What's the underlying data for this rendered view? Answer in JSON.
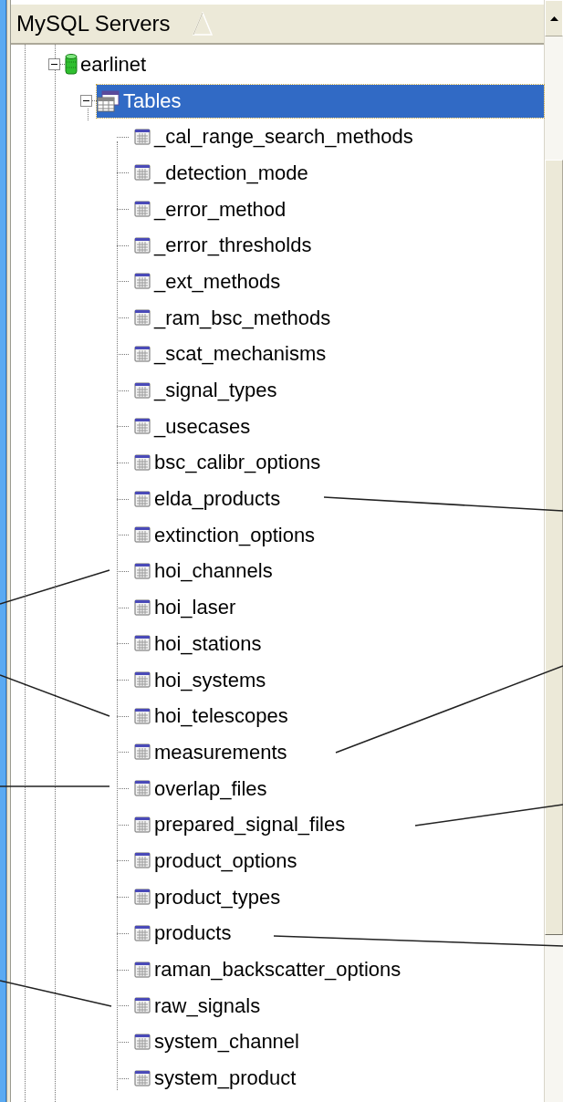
{
  "header": {
    "title": "MySQL Servers"
  },
  "tree": [
    {
      "label": "earlinet",
      "kind": "database",
      "expanded": true,
      "selected": false,
      "children": [
        {
          "label": "Tables",
          "kind": "folder",
          "expanded": true,
          "selected": true,
          "children": [
            {
              "label": "_cal_range_search_methods",
              "kind": "table",
              "selected": false
            },
            {
              "label": "_detection_mode",
              "kind": "table",
              "selected": false
            },
            {
              "label": "_error_method",
              "kind": "table",
              "selected": false
            },
            {
              "label": "_error_thresholds",
              "kind": "table",
              "selected": false
            },
            {
              "label": "_ext_methods",
              "kind": "table",
              "selected": false
            },
            {
              "label": "_ram_bsc_methods",
              "kind": "table",
              "selected": false
            },
            {
              "label": "_scat_mechanisms",
              "kind": "table",
              "selected": false
            },
            {
              "label": "_signal_types",
              "kind": "table",
              "selected": false
            },
            {
              "label": "_usecases",
              "kind": "table",
              "selected": false
            },
            {
              "label": "bsc_calibr_options",
              "kind": "table",
              "selected": false
            },
            {
              "label": "elda_products",
              "kind": "table",
              "selected": false
            },
            {
              "label": "extinction_options",
              "kind": "table",
              "selected": false
            },
            {
              "label": "hoi_channels",
              "kind": "table",
              "selected": false
            },
            {
              "label": "hoi_laser",
              "kind": "table",
              "selected": false
            },
            {
              "label": "hoi_stations",
              "kind": "table",
              "selected": false
            },
            {
              "label": "hoi_systems",
              "kind": "table",
              "selected": false
            },
            {
              "label": "hoi_telescopes",
              "kind": "table",
              "selected": false
            },
            {
              "label": "measurements",
              "kind": "table",
              "selected": false
            },
            {
              "label": "overlap_files",
              "kind": "table",
              "selected": false
            },
            {
              "label": "prepared_signal_files",
              "kind": "table",
              "selected": false
            },
            {
              "label": "product_options",
              "kind": "table",
              "selected": false
            },
            {
              "label": "product_types",
              "kind": "table",
              "selected": false
            },
            {
              "label": "products",
              "kind": "table",
              "selected": false
            },
            {
              "label": "raman_backscatter_options",
              "kind": "table",
              "selected": false
            },
            {
              "label": "raw_signals",
              "kind": "table",
              "selected": false
            },
            {
              "label": "system_channel",
              "kind": "table",
              "selected": false
            },
            {
              "label": "system_product",
              "kind": "table",
              "selected": false
            }
          ]
        }
      ]
    }
  ]
}
